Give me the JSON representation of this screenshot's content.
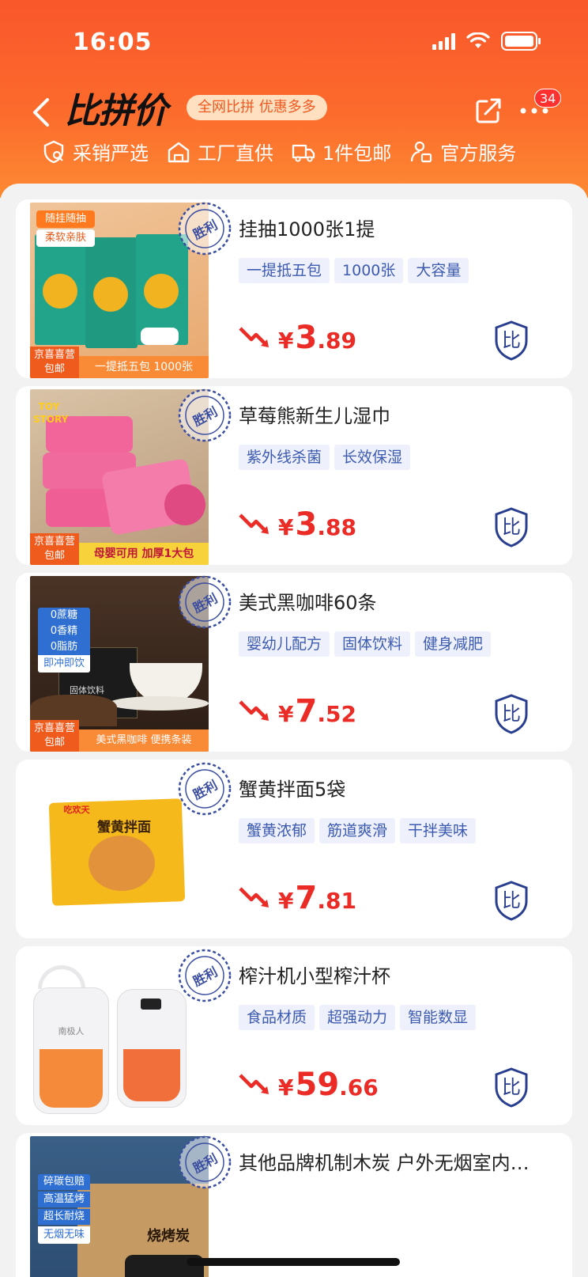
{
  "status_bar": {
    "time": "16:05"
  },
  "nav": {
    "title": "比拼价",
    "slogan": "全网比拼 优惠多多",
    "more_badge": "34"
  },
  "features": [
    {
      "icon": "shield-check-icon",
      "label": "采销严选"
    },
    {
      "icon": "house-icon",
      "label": "工厂直供"
    },
    {
      "icon": "truck-icon",
      "label": "1件包邮"
    },
    {
      "icon": "service-icon",
      "label": "官方服务"
    }
  ],
  "colors": {
    "brand_orange": "#f9572b",
    "price_red": "#ea2b26",
    "tag_blue": "#3d5bb0",
    "tag_bg": "#eef1fb"
  },
  "products": [
    {
      "title": "挂抽1000张1提",
      "tags": [
        "一提抵五包",
        "1000张",
        "大容量"
      ],
      "price_int": "3",
      "price_dec": ".89",
      "stamp": "胜利",
      "img_labels": {
        "top": "随挂随抽",
        "sub": "柔软亲肤",
        "corner": "京喜喜营\n包邮",
        "bottom": "一提抵五包 1000张"
      }
    },
    {
      "title": "草莓熊新生儿湿巾",
      "tags": [
        "紫外线杀菌",
        "长效保湿"
      ],
      "price_int": "3",
      "price_dec": ".88",
      "stamp": "胜利",
      "img_labels": {
        "top": "TOY STORY",
        "corner": "京喜喜营\n包邮",
        "bottom": "母婴可用 加厚1大包"
      }
    },
    {
      "title": "美式黑咖啡60条",
      "tags": [
        "婴幼儿配方",
        "固体饮料",
        "健身减肥"
      ],
      "price_int": "7",
      "price_dec": ".52",
      "stamp": "胜利",
      "img_labels": {
        "l1": "0蔗糖",
        "l2": "0香精",
        "l3": "0脂肪",
        "l4": "即冲即饮",
        "mid": "固体饮料",
        "corner": "京喜喜营\n包邮",
        "bottom": "美式黑咖啡 便携条装"
      }
    },
    {
      "title": "蟹黄拌面5袋",
      "tags": [
        "蟹黄浓郁",
        "筋道爽滑",
        "干拌美味"
      ],
      "price_int": "7",
      "price_dec": ".81",
      "stamp": "胜利",
      "img_labels": {
        "pkg": "蟹黄拌面",
        "brand": "吃欢天"
      }
    },
    {
      "title": "榨汁机小型榨汁杯",
      "tags": [
        "食品材质",
        "超强动力",
        "智能数显"
      ],
      "price_int": "59",
      "price_dec": ".66",
      "stamp": "胜利",
      "img_labels": {
        "brand": "南极人"
      }
    },
    {
      "title": "其他品牌机制木炭 户外无烟室内…",
      "tags": [],
      "price_int": "",
      "price_dec": "",
      "stamp": "胜利",
      "img_labels": {
        "l1": "碎碳包赔",
        "l2": "高温猛烤",
        "l3": "超长耐烧",
        "l4": "无烟无味",
        "box": "烧烤炭"
      }
    }
  ],
  "compare_label": "比"
}
